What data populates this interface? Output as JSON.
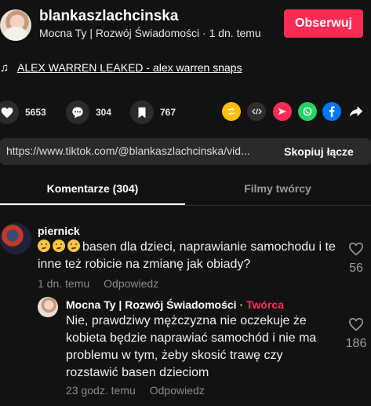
{
  "header": {
    "username": "blankaszlachcinska",
    "subline": "Mocna Ty | Rozwój Świadomości · 1 dn. temu",
    "follow_label": "Obserwuj"
  },
  "music": {
    "icon": "music-note-icon",
    "title": "ALEX WARREN LEAKED - alex warren snaps"
  },
  "actions": {
    "likes": "5653",
    "comments": "304",
    "saves": "767",
    "share_icons": [
      "repost-icon",
      "embed-icon",
      "send-icon",
      "whatsapp-icon",
      "facebook-icon",
      "share-arrow-icon"
    ],
    "colors": {
      "repost": "#ffbe00",
      "embed": "#2f2f2f",
      "send": "#fe2c55",
      "whatsapp": "#25d366",
      "facebook": "#0075fa"
    }
  },
  "url_bar": {
    "url": "https://www.tiktok.com/@blankaszlachcinska/vid...",
    "copy_label": "Skopiuj łącze"
  },
  "tabs": [
    {
      "label": "Komentarze (304)",
      "active": true
    },
    {
      "label": "Filmy twórcy",
      "active": false
    }
  ],
  "comments": [
    {
      "author": "piernick",
      "text": "basen dla dzieci, naprawianie samochodu i te inne też robicie na zmianę jak obiady?",
      "time": "1 dn. temu",
      "reply_label": "Odpowiedz",
      "likes": "56"
    },
    {
      "author": "Mocna Ty | Rozwój Świadomości",
      "badge": "Twórca",
      "text": "Nie, prawdziwy mężczyzna nie oczekuje że kobieta będzie naprawiać samochód i nie ma problemu w tym, żeby skosić trawę czy rozstawić basen dzieciom",
      "time": "23 godz. temu",
      "reply_label": "Odpowiedz",
      "likes": "186"
    }
  ],
  "colors": {
    "background": "#121212",
    "accent": "#fe2c55",
    "muted_text": "#8a8a8a"
  }
}
